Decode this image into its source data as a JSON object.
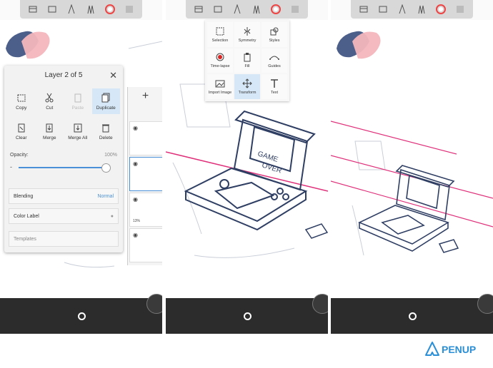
{
  "panel1": {
    "layer_dialog": {
      "title": "Layer 2 of 5",
      "actions": [
        {
          "label": "Copy",
          "icon": "copy-icon",
          "state": "normal"
        },
        {
          "label": "Cut",
          "icon": "scissors-icon",
          "state": "normal"
        },
        {
          "label": "Paste",
          "icon": "paste-icon",
          "state": "disabled"
        },
        {
          "label": "Duplicate",
          "icon": "duplicate-icon",
          "state": "selected"
        },
        {
          "label": "Clear",
          "icon": "clear-icon",
          "state": "normal"
        },
        {
          "label": "Merge",
          "icon": "merge-icon",
          "state": "normal"
        },
        {
          "label": "Merge All",
          "icon": "merge-all-icon",
          "state": "normal"
        },
        {
          "label": "Delete",
          "icon": "trash-icon",
          "state": "normal"
        }
      ],
      "opacity_label": "Opacity:",
      "opacity_value": "100%",
      "opacity_minus": "-",
      "blending_label": "Blending",
      "blending_value": "Normal",
      "color_label": "Color Label",
      "templates_label": "Templates"
    },
    "layer_strip": {
      "add": "+",
      "badge": "13%"
    }
  },
  "panel2": {
    "tools": [
      {
        "label": "Selection",
        "icon": "selection-icon"
      },
      {
        "label": "Symmetry",
        "icon": "symmetry-icon"
      },
      {
        "label": "Styles",
        "icon": "styles-icon"
      },
      {
        "label": "Time-lapse",
        "icon": "record-icon"
      },
      {
        "label": "Fill",
        "icon": "fill-bucket-icon"
      },
      {
        "label": "Guides",
        "icon": "guides-icon"
      },
      {
        "label": "Import Image",
        "icon": "import-image-icon"
      },
      {
        "label": "Transform",
        "icon": "transform-icon",
        "selected": true
      },
      {
        "label": "Text",
        "icon": "text-icon"
      }
    ]
  },
  "brand": {
    "name": "PENUP",
    "color": "#2a8fd6"
  },
  "colors": {
    "accent": "#4a90d9",
    "guide_line": "#e0307a",
    "sketch": "#2f3e63",
    "swatch_blue": "#4c5f8a",
    "swatch_pink": "#f3b6bd"
  }
}
